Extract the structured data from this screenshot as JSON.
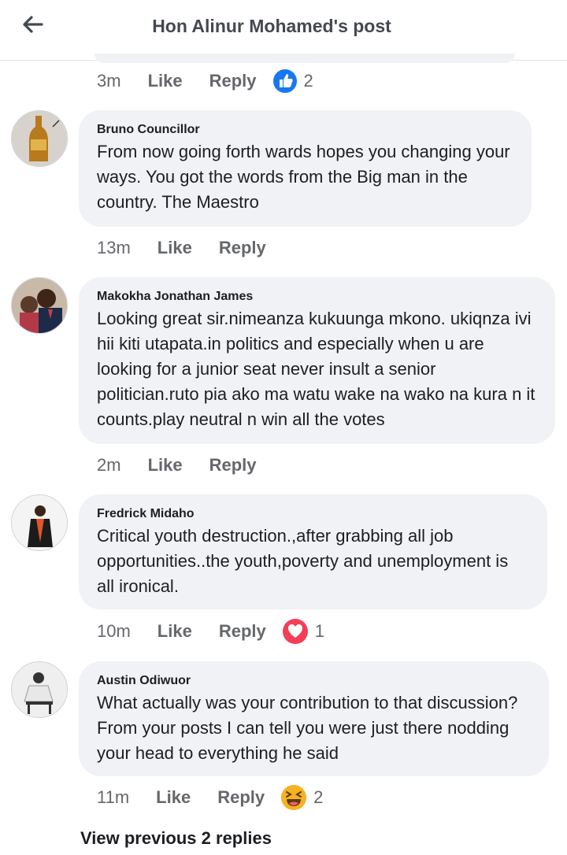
{
  "header": {
    "title": "Hon Alinur Mohamed's post"
  },
  "top_meta": {
    "time": "3m",
    "like": "Like",
    "reply": "Reply",
    "reaction_count": "2"
  },
  "comments": [
    {
      "author": "Bruno Councillor",
      "text": "From now going forth wards hopes you changing your ways. You got the words from the Big man in the country. The Maestro",
      "time": "13m",
      "like": "Like",
      "reply": "Reply"
    },
    {
      "author": "Makokha Jonathan James",
      "text": "Looking great sir.nimeanza kukuunga mkono. ukiqnza ivi hii kiti utapata.in politics and especially when u are looking for a junior seat never insult a senior politician.ruto pia ako ma watu wake na wako na kura n it counts.play neutral n win all the votes",
      "time": "2m",
      "like": "Like",
      "reply": "Reply"
    },
    {
      "author": "Fredrick Midaho",
      "text": "Critical youth destruction.,after grabbing all job opportunities..the youth,poverty and unemployment is all ironical.",
      "time": "10m",
      "like": "Like",
      "reply": "Reply",
      "reaction_count": "1"
    },
    {
      "author": "Austin Odiwuor",
      "text": "What actually was your contribution to that discussion? From your posts I can tell you were just there nodding your head to everything he said",
      "time": "11m",
      "like": "Like",
      "reply": "Reply",
      "reaction_count": "2"
    }
  ],
  "view_previous": "View previous 2 replies",
  "icons": {
    "back": "arrow-left-icon",
    "like_reaction": "thumbs-up-icon",
    "love_reaction": "heart-icon",
    "haha_reaction": "laughing-face-icon"
  },
  "colors": {
    "like_blue": "#1877f2",
    "love_red": "#f33e58",
    "haha_yellow": "#f7b125"
  }
}
